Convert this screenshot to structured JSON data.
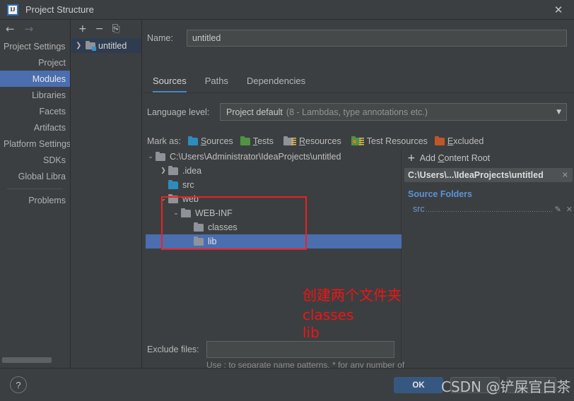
{
  "window": {
    "title": "Project Structure",
    "logo_text": "IJ",
    "close_icon": "✕"
  },
  "nav": {
    "back_icon": "←",
    "forward_icon": "→"
  },
  "sidebar": {
    "items": [
      {
        "label": "Project Settings",
        "type": "header",
        "selected": false
      },
      {
        "label": "Project",
        "type": "child",
        "selected": false
      },
      {
        "label": "Modules",
        "type": "child",
        "selected": true
      },
      {
        "label": "Libraries",
        "type": "child",
        "selected": false
      },
      {
        "label": "Facets",
        "type": "child",
        "selected": false
      },
      {
        "label": "Artifacts",
        "type": "child",
        "selected": false
      },
      {
        "label": "Platform Settings",
        "type": "header",
        "selected": false
      },
      {
        "label": "SDKs",
        "type": "child",
        "selected": false
      },
      {
        "label": "Global Libra",
        "type": "child",
        "selected": false
      }
    ],
    "problems_label": "Problems"
  },
  "module_panel": {
    "toolbar": {
      "add_icon": "+",
      "remove_icon": "−",
      "copy_icon": "⎘"
    },
    "modules": [
      {
        "label": "untitled",
        "expander": "❯",
        "selected": true
      }
    ]
  },
  "main": {
    "name_label": "Name:",
    "name_value": "untitled",
    "tabs": [
      {
        "label": "Sources",
        "active": true
      },
      {
        "label": "Paths",
        "active": false
      },
      {
        "label": "Dependencies",
        "active": false
      }
    ],
    "language_level_label": "Language level:",
    "language_level_value": "Project default",
    "language_level_detail": "(8 - Lambdas, type annotations etc.)",
    "combo_caret": "▼",
    "mark_as_label": "Mark as:",
    "mark_as_options": [
      {
        "label": "Sources",
        "mnemonic": "S",
        "rest": "ources",
        "color": "blue"
      },
      {
        "label": "Tests",
        "mnemonic": "T",
        "rest": "ests",
        "color": "green"
      },
      {
        "label": "Resources",
        "mnemonic": "R",
        "rest": "esources",
        "color": "gray"
      },
      {
        "label": "Test Resources",
        "mnemonic": "",
        "rest": "Test Resources",
        "color": "tres"
      },
      {
        "label": "Excluded",
        "mnemonic": "E",
        "rest": "xcluded",
        "color": "orange"
      }
    ],
    "tree": [
      {
        "label": "C:\\Users\\Administrator\\IdeaProjects\\untitled",
        "depth": 0,
        "expander": "⌄",
        "folder": "gray",
        "selected": false
      },
      {
        "label": ".idea",
        "depth": 1,
        "expander": "❯",
        "folder": "gray",
        "selected": false
      },
      {
        "label": "src",
        "depth": 1,
        "expander": "",
        "folder": "blue",
        "selected": false
      },
      {
        "label": "web",
        "depth": 1,
        "expander": "⌄",
        "folder": "gray",
        "selected": false
      },
      {
        "label": "WEB-INF",
        "depth": 2,
        "expander": "⌄",
        "folder": "gray",
        "selected": false
      },
      {
        "label": "classes",
        "depth": 3,
        "expander": "",
        "folder": "gray",
        "selected": false
      },
      {
        "label": "lib",
        "depth": 3,
        "expander": "",
        "folder": "gray",
        "selected": true
      }
    ],
    "roots": {
      "add_content_root_plus": "+",
      "add_content_root_label": "Add Content Root",
      "add_content_root_mnemonic": "C",
      "content_root_path": "C:\\Users\\...\\IdeaProjects\\untitled",
      "remove_icon": "✕",
      "source_folders_heading": "Source Folders",
      "source_folders": [
        {
          "label": "src",
          "edit_icon": "✎",
          "remove_icon": "✕"
        }
      ]
    },
    "exclude_label": "Exclude files:",
    "exclude_value": "",
    "exclude_hint": "Use ; to separate name patterns, * for any number of symbols, ? for one."
  },
  "bottom": {
    "help_icon": "?",
    "ok_label": "OK",
    "cancel_label": "",
    "apply_label": ""
  },
  "annotations": {
    "line1": "创建两个文件夹",
    "line2": "classes",
    "line3": "lib",
    "box_color": "#ef2020",
    "text_color": "#f01414"
  },
  "watermark": {
    "text": "CSDN @铲屎官白茶"
  }
}
